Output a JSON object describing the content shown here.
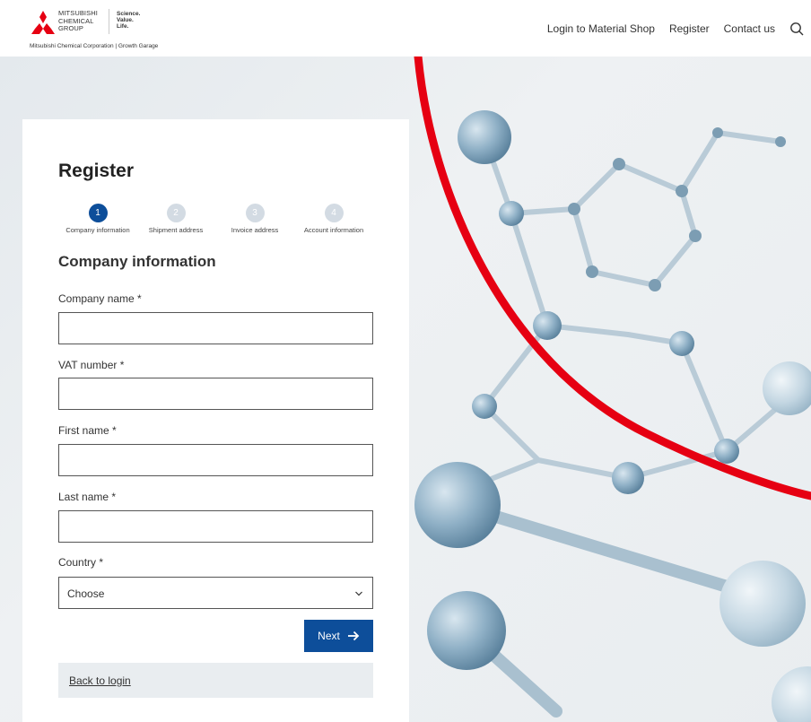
{
  "header": {
    "logo_group_lines": [
      "MITSUBISHI",
      "CHEMICAL",
      "GROUP"
    ],
    "logo_tag_lines": [
      "Science.",
      "Value.",
      "Life."
    ],
    "logo_subtitle": "Mitsubishi Chemical Corporation | Growth Garage",
    "nav": [
      {
        "label": "Login to Material Shop"
      },
      {
        "label": "Register"
      },
      {
        "label": "Contact us"
      }
    ],
    "search_icon": "search-icon"
  },
  "form": {
    "title": "Register",
    "steps": [
      {
        "number": "1",
        "label": "Company information",
        "active": true
      },
      {
        "number": "2",
        "label": "Shipment address",
        "active": false
      },
      {
        "number": "3",
        "label": "Invoice address",
        "active": false
      },
      {
        "number": "4",
        "label": "Account information",
        "active": false
      }
    ],
    "section_title": "Company information",
    "fields": {
      "company_name": {
        "label": "Company name *",
        "value": ""
      },
      "vat_number": {
        "label": "VAT number *",
        "value": ""
      },
      "first_name": {
        "label": "First name *",
        "value": ""
      },
      "last_name": {
        "label": "Last name *",
        "value": ""
      },
      "country": {
        "label": "Country *",
        "selected": "Choose"
      }
    },
    "next_label": "Next",
    "back_label": "Back to login"
  },
  "colors": {
    "primary": "#0d4e9a",
    "step_inactive": "#d3dbe3",
    "accent_red": "#e60012",
    "back_box": "#e9edf0"
  }
}
